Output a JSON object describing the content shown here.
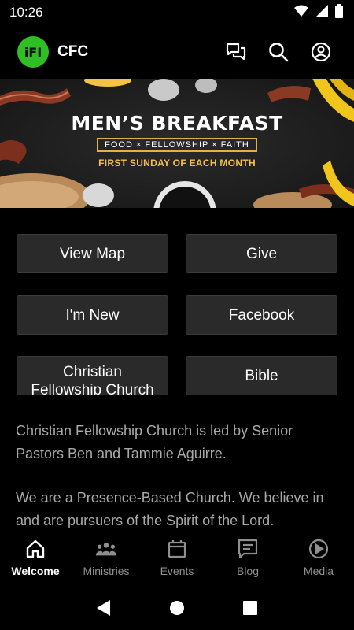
{
  "status_bar": {
    "time": "10:26"
  },
  "app_bar": {
    "logo_text": "iFI",
    "title": "CFC"
  },
  "banner": {
    "title": "MEN’S BREAKFAST",
    "tagline": "FOOD × FELLOWSHIP × FAITH",
    "schedule": "FIRST SUNDAY OF EACH MONTH"
  },
  "buttons": [
    {
      "label": "View Map"
    },
    {
      "label": "Give"
    },
    {
      "label": "I'm New"
    },
    {
      "label": "Facebook"
    },
    {
      "label_line1": "Christian",
      "label_line2": "Fellowship Church"
    },
    {
      "label": "Bible"
    }
  ],
  "description": {
    "paragraph1": "Christian Fellowship Church is led by Senior Pastors Ben and Tammie Aguirre.",
    "paragraph2": "We are a Presence-Based Church. We believe in and are pursuers of the Spirit of the Lord."
  },
  "bottom_nav": {
    "items": [
      {
        "label": "Welcome",
        "icon": "home-icon",
        "active": true
      },
      {
        "label": "Ministries",
        "icon": "people-icon",
        "active": false
      },
      {
        "label": "Events",
        "icon": "calendar-icon",
        "active": false
      },
      {
        "label": "Blog",
        "icon": "article-icon",
        "active": false
      },
      {
        "label": "Media",
        "icon": "play-circle-icon",
        "active": false
      }
    ]
  },
  "colors": {
    "background": "#000000",
    "button_bg": "#2a2a2a",
    "accent_gold": "#f2c14e",
    "logo_green": "#2fbf24",
    "muted_text": "#a8a8a8"
  }
}
